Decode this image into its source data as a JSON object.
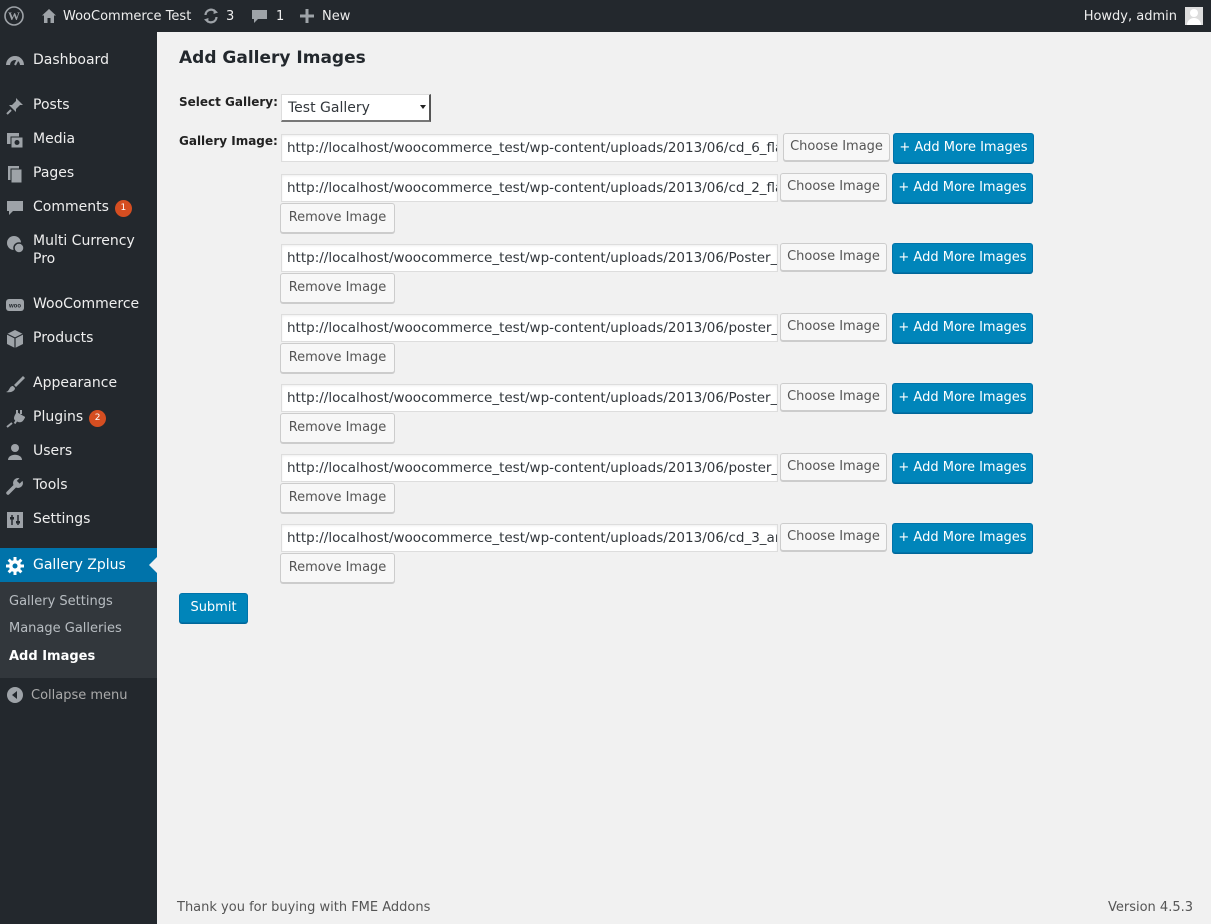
{
  "adminbar": {
    "site_name": "WooCommerce Test",
    "updates_count": "3",
    "comments_count": "1",
    "new_label": "New",
    "greeting": "Howdy, admin"
  },
  "sidebar": {
    "items": [
      {
        "label": "Dashboard",
        "icon": "dashboard-icon"
      },
      {
        "label": "Posts",
        "icon": "pin-icon"
      },
      {
        "label": "Media",
        "icon": "media-icon"
      },
      {
        "label": "Pages",
        "icon": "pages-icon"
      },
      {
        "label": "Comments",
        "icon": "comment-icon",
        "badge": "1"
      },
      {
        "label": "Multi Currency Pro",
        "icon": "currency-icon"
      },
      {
        "label": "WooCommerce",
        "icon": "woo-icon"
      },
      {
        "label": "Products",
        "icon": "box-icon"
      },
      {
        "label": "Appearance",
        "icon": "brush-icon"
      },
      {
        "label": "Plugins",
        "icon": "plug-icon",
        "badge": "2"
      },
      {
        "label": "Users",
        "icon": "user-icon"
      },
      {
        "label": "Tools",
        "icon": "wrench-icon"
      },
      {
        "label": "Settings",
        "icon": "settings-icon"
      },
      {
        "label": "Gallery Zplus",
        "icon": "gear-icon"
      }
    ],
    "submenu": [
      "Gallery Settings",
      "Manage Galleries",
      "Add Images"
    ],
    "collapse_label": "Collapse menu"
  },
  "main": {
    "title": "Add Gallery Images",
    "select_gallery_label": "Select Gallery:",
    "selected_gallery": "Test Gallery",
    "gallery_image_label": "Gallery Image:",
    "choose_label": "Choose Image",
    "add_more_label": "+ Add More Images",
    "remove_label": "Remove Image",
    "submit_label": "Submit",
    "images": [
      "http://localhost/woocommerce_test/wp-content/uploads/2013/06/cd_6_fla",
      "http://localhost/woocommerce_test/wp-content/uploads/2013/06/cd_2_fla",
      "http://localhost/woocommerce_test/wp-content/uploads/2013/06/Poster_",
      "http://localhost/woocommerce_test/wp-content/uploads/2013/06/poster_",
      "http://localhost/woocommerce_test/wp-content/uploads/2013/06/Poster_",
      "http://localhost/woocommerce_test/wp-content/uploads/2013/06/poster_",
      "http://localhost/woocommerce_test/wp-content/uploads/2013/06/cd_3_ar"
    ]
  },
  "footer": {
    "thanks": "Thank you for buying with FME Addons",
    "version": "Version 4.5.3"
  },
  "colors": {
    "admin_dark": "#23282d",
    "accent_blue": "#0073aa",
    "primary_button": "#0085ba",
    "badge": "#d54e21",
    "background": "#f1f1f1"
  }
}
